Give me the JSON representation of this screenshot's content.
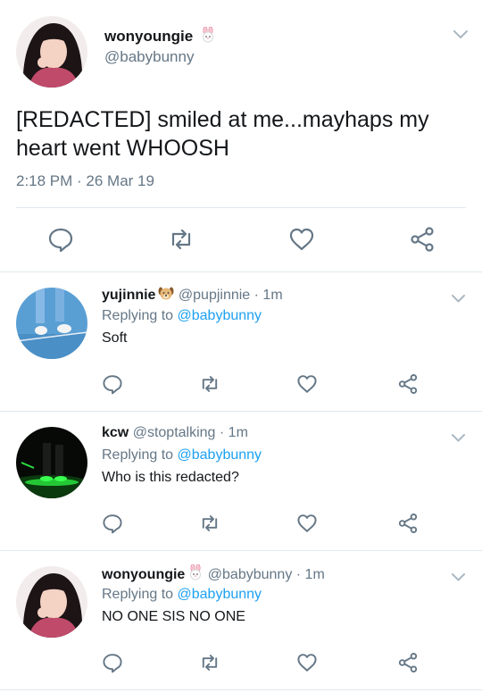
{
  "main_tweet": {
    "display_name": "wonyoungie",
    "name_emoji": "bunny-face-icon",
    "handle": "@babybunny",
    "text": "[REDACTED] smiled at me...mayhaps my heart went WHOOSH",
    "timestamp": "2:18 PM · 26 Mar 19"
  },
  "replies": [
    {
      "display_name": "yujinnie",
      "name_emoji": "dog-face-icon",
      "handle": "@pupjinnie",
      "time": "· 1m",
      "replying_prefix": "Replying to",
      "replying_to": "@babybunny",
      "text": "Soft"
    },
    {
      "display_name": "kcw",
      "handle": "@stoptalking",
      "time": "· 1m",
      "replying_prefix": "Replying to",
      "replying_to": "@babybunny",
      "text": "Who is this redacted?"
    },
    {
      "display_name": "wonyoungie",
      "name_emoji": "bunny-face-icon",
      "handle": "@babybunny",
      "time": "· 1m",
      "replying_prefix": "Replying to",
      "replying_to": "@babybunny",
      "text": "NO ONE SIS NO ONE"
    }
  ],
  "actions": [
    "reply-icon",
    "retweet-icon",
    "like-icon",
    "share-icon"
  ],
  "colors": {
    "text": "#14171a",
    "secondary": "#657786",
    "link": "#1da1f2",
    "divider": "#e1e8ed"
  }
}
